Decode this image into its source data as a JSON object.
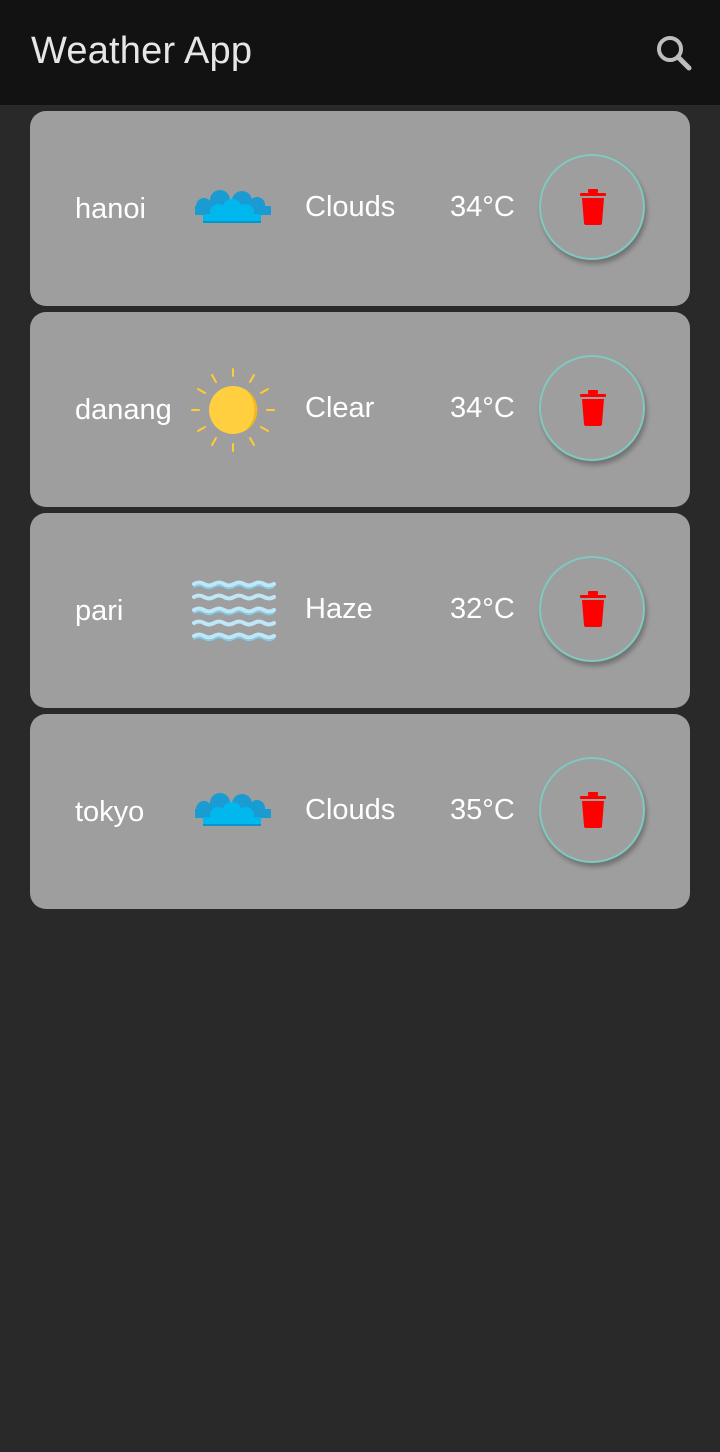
{
  "app": {
    "title": "Weather App",
    "search_icon": "search-icon"
  },
  "colors": {
    "appbar_bg": "#121212",
    "page_bg": "#292929",
    "card_bg": "#9e9e9e",
    "delete_icon": "#ff0000",
    "delete_ring": "#7fc9c0"
  },
  "cities": [
    {
      "name": "hanoi",
      "condition": "Clouds",
      "temp": "34°C",
      "icon": "clouds-icon"
    },
    {
      "name": "danang",
      "condition": "Clear",
      "temp": "34°C",
      "icon": "sun-icon"
    },
    {
      "name": "pari",
      "condition": "Haze",
      "temp": "32°C",
      "icon": "haze-icon"
    },
    {
      "name": "tokyo",
      "condition": "Clouds",
      "temp": "35°C",
      "icon": "clouds-icon"
    }
  ]
}
